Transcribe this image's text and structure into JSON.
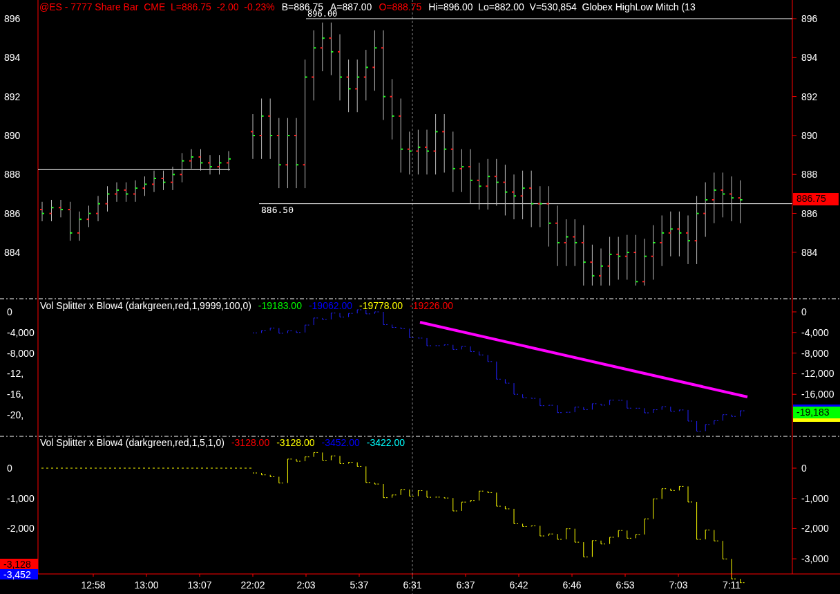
{
  "price_panel": {
    "header": [
      {
        "text": "@ES - 7777 Share Bar  CME  L=886.75  -2.00  -0.23%",
        "color": "#ff0000"
      },
      {
        "text": "B=886.75",
        "color": "#ffffff"
      },
      {
        "text": "A=887.00",
        "color": "#ffffff"
      },
      {
        "text": "O=888.75",
        "color": "#ff0000"
      },
      {
        "text": "Hi=896.00  Lo=882.00  V=530,854  Globex HighLow Mitch (13",
        "color": "#ffffff"
      }
    ],
    "left_labels": [
      "896",
      "894",
      "892",
      "890",
      "888",
      "886",
      "884"
    ],
    "right_labels": [
      "896",
      "894",
      "892",
      "890",
      "888",
      "886",
      "884"
    ],
    "level_labels": [
      {
        "text": "896.00"
      },
      {
        "text": "886.50"
      }
    ],
    "last_price": "886.75"
  },
  "indicator_1": {
    "title": "Vol Splitter x Blow4 (darkgreen,red,1,9999,100,0)",
    "values": [
      {
        "text": "-19183.00",
        "color": "#00ff00"
      },
      {
        "text": "-19062.00",
        "color": "#0000ff"
      },
      {
        "text": "-19778.00",
        "color": "#ffff00"
      },
      {
        "text": "-19226.00",
        "color": "#ff0000"
      }
    ],
    "left_labels": [
      "0",
      "-4,000",
      "-8,000",
      "-12,",
      "-16,",
      "-20,"
    ],
    "right_labels": [
      "0",
      "-4,000",
      "-8,000",
      "-12,000",
      "-16,000"
    ],
    "last_value": "-19,183"
  },
  "indicator_2": {
    "title": "Vol Splitter x Blow4 (darkgreen,red,1,5,1,0)",
    "values": [
      {
        "text": "-3128.00",
        "color": "#ff0000"
      },
      {
        "text": "-3128.00",
        "color": "#ffff00"
      },
      {
        "text": "-3452.00",
        "color": "#0000ff"
      },
      {
        "text": "-3422.00",
        "color": "#00ffff"
      }
    ],
    "left_labels": [
      "0",
      "-1,000",
      "-2,000"
    ],
    "right_labels": [
      "0",
      "-1,000",
      "-2,000",
      "-3,000"
    ],
    "left_values": [
      {
        "text": "-3,128",
        "color": "#ff0000"
      },
      {
        "text": "-3,452",
        "color": "#0000ff"
      }
    ]
  },
  "time_axis": [
    "12:58",
    "13:00",
    "13:07",
    "22:02",
    "2:03",
    "5:37",
    "6:31",
    "6:37",
    "6:42",
    "6:46",
    "6:53",
    "7:03",
    "7:11"
  ]
}
